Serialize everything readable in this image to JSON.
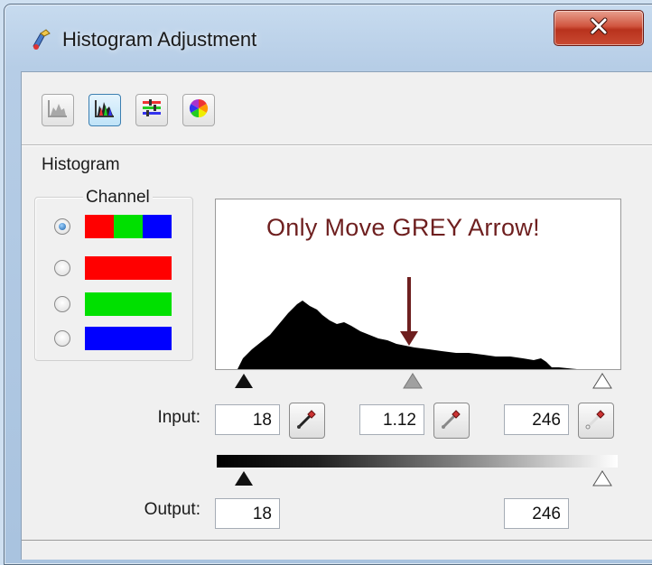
{
  "window": {
    "title": "Histogram Adjustment"
  },
  "toolbar": {
    "buttons": [
      {
        "name": "histogram-gray-icon",
        "active": false
      },
      {
        "name": "histogram-color-icon",
        "active": true
      },
      {
        "name": "color-balance-icon",
        "active": false
      },
      {
        "name": "color-wheel-icon",
        "active": false
      }
    ]
  },
  "section": {
    "label": "Histogram"
  },
  "channel": {
    "label": "Channel",
    "options": [
      {
        "name": "RGB",
        "colors": [
          "#ff0000",
          "#00e000",
          "#0000ff"
        ],
        "selected": true
      },
      {
        "name": "Red",
        "colors": [
          "#ff0000"
        ],
        "selected": false
      },
      {
        "name": "Green",
        "colors": [
          "#00e000"
        ],
        "selected": false
      },
      {
        "name": "Blue",
        "colors": [
          "#0000ff"
        ],
        "selected": false
      }
    ]
  },
  "histogram": {
    "annotation": "Only Move GREY Arrow!",
    "annotation_color": "#6e1f1f",
    "black_point_value": 18,
    "gamma_value": 1.12,
    "white_point_value": 246
  },
  "input": {
    "label": "Input:",
    "black": "18",
    "gamma": "1.12",
    "white": "246"
  },
  "output": {
    "label": "Output:",
    "black": "18",
    "white": "246"
  }
}
